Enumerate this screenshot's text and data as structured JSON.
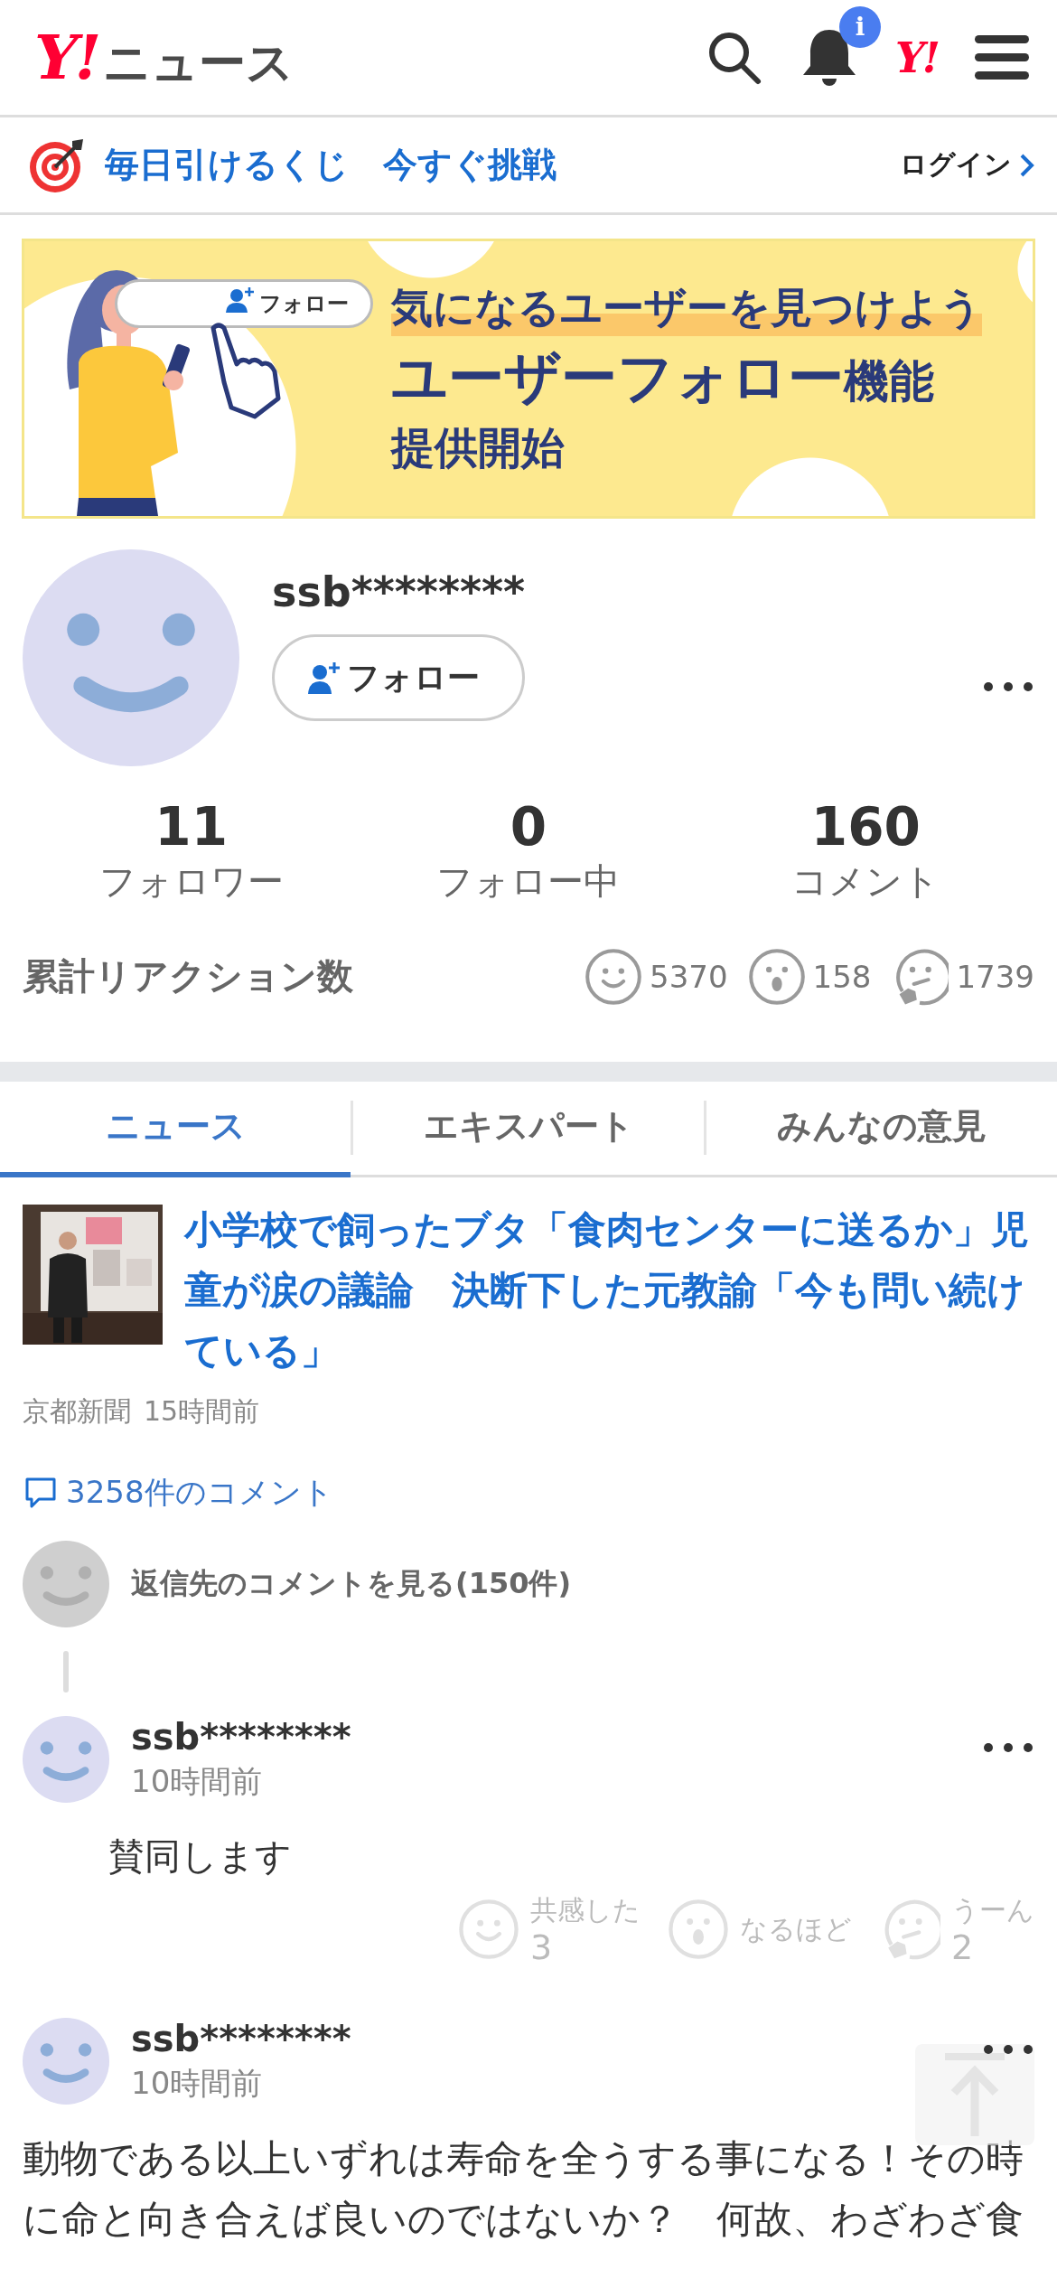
{
  "header": {
    "logo": "Y!",
    "service": "ニュース",
    "notification_badge": "i",
    "yahoo_link": "Y!"
  },
  "promo_bar": {
    "text": "毎日引けるくじ　今すぐ挑戦",
    "login": "ログイン"
  },
  "banner": {
    "button": "フォロー",
    "tagline": "気になるユーザーを見つけよう",
    "headline": "ユーザーフォロー",
    "headline_suffix": "機能",
    "subline": "提供開始"
  },
  "profile": {
    "username": "ssb********",
    "follow_button": "フォロー",
    "stats": [
      {
        "value": "11",
        "label": "フォロワー"
      },
      {
        "value": "0",
        "label": "フォロー中"
      },
      {
        "value": "160",
        "label": "コメント"
      }
    ],
    "reactions_label": "累計リアクション数",
    "reactions": [
      {
        "kind": "smile",
        "count": "5370"
      },
      {
        "kind": "surprised",
        "count": "158"
      },
      {
        "kind": "thinking",
        "count": "1739"
      }
    ]
  },
  "tabs": [
    {
      "label": "ニュース",
      "selected": true
    },
    {
      "label": "エキスパート",
      "selected": false
    },
    {
      "label": "みんなの意見",
      "selected": false
    }
  ],
  "article": {
    "title": "小学校で飼ったブタ「食肉センターに送るか」児童が涙の議論　決断下した元教諭「今も問い続けている」",
    "source": "京都新聞",
    "time": "15時間前",
    "comments_link": "3258件のコメント"
  },
  "parent_comment": {
    "text": "返信先のコメントを見る(150件)"
  },
  "comments": [
    {
      "username": "ssb********",
      "time": "10時間前",
      "body": "賛同します",
      "reactions": [
        {
          "kind": "smile",
          "label": "共感した",
          "count": "3"
        },
        {
          "kind": "surprised",
          "label": "なるほど"
        },
        {
          "kind": "thinking",
          "label": "うーん",
          "count": "2"
        }
      ]
    },
    {
      "username": "ssb********",
      "time": "10時間前",
      "body": "動物である以上いずれは寿命を全うする事になる！その時に命と向き合えば良いのではないか？　何故、わざわざ食"
    }
  ]
}
